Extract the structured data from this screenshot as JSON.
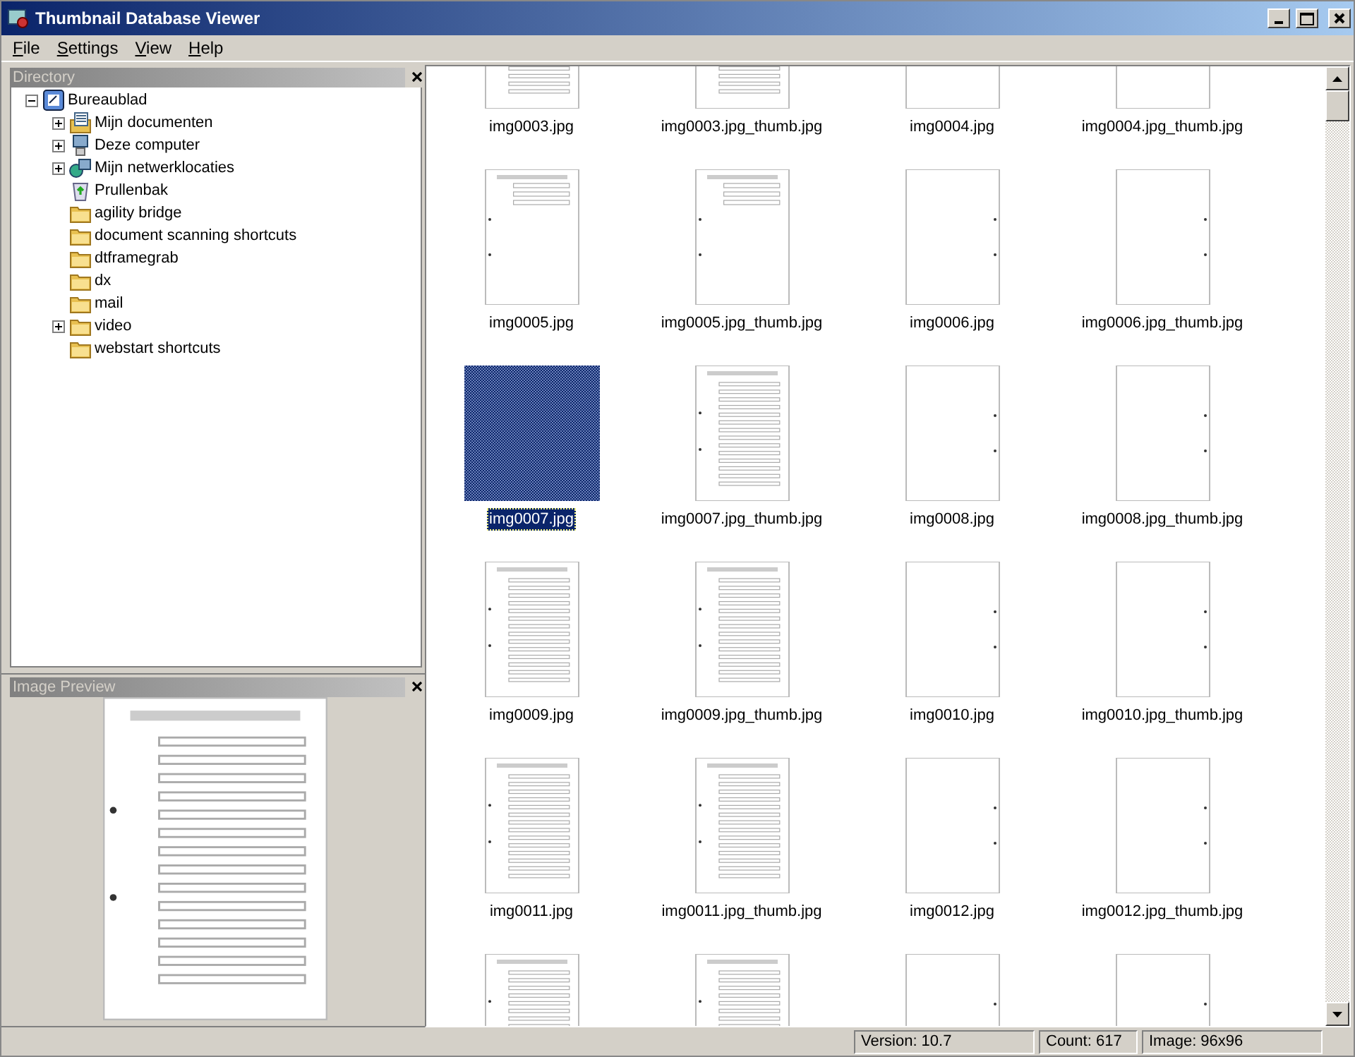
{
  "window": {
    "title": "Thumbnail Database Viewer"
  },
  "menu": [
    "File",
    "Settings",
    "View",
    "Help"
  ],
  "directory": {
    "title": "Directory",
    "tree": [
      {
        "label": "Bureaublad",
        "kind": "desktop",
        "expanded": true,
        "children": [
          {
            "label": "Mijn documenten",
            "kind": "documents",
            "expanded": false
          },
          {
            "label": "Deze computer",
            "kind": "computer",
            "expanded": false
          },
          {
            "label": "Mijn netwerklocaties",
            "kind": "network",
            "expanded": false
          },
          {
            "label": "Prullenbak",
            "kind": "recycle"
          },
          {
            "label": "agility bridge",
            "kind": "folder"
          },
          {
            "label": "document scanning shortcuts",
            "kind": "folder"
          },
          {
            "label": "dtframegrab",
            "kind": "folder"
          },
          {
            "label": "dx",
            "kind": "folder"
          },
          {
            "label": "mail",
            "kind": "folder"
          },
          {
            "label": "video",
            "kind": "folder",
            "expanded": false
          },
          {
            "label": "webstart shortcuts",
            "kind": "folder"
          }
        ]
      }
    ]
  },
  "preview": {
    "title": "Image Preview",
    "kind": "picture"
  },
  "thumbnails": [
    {
      "label": "img0003.jpg",
      "kind": "table",
      "selected": false
    },
    {
      "label": "img0003.jpg_thumb.jpg",
      "kind": "table",
      "selected": false
    },
    {
      "label": "img0004.jpg",
      "kind": "blank",
      "selected": false
    },
    {
      "label": "img0004.jpg_thumb.jpg",
      "kind": "blank",
      "selected": false
    },
    {
      "label": "img0005.jpg",
      "kind": "sparse",
      "selected": false
    },
    {
      "label": "img0005.jpg_thumb.jpg",
      "kind": "sparse",
      "selected": false
    },
    {
      "label": "img0006.jpg",
      "kind": "blank",
      "selected": false
    },
    {
      "label": "img0006.jpg_thumb.jpg",
      "kind": "blank",
      "selected": false
    },
    {
      "label": "img0007.jpg",
      "kind": "table",
      "selected": true
    },
    {
      "label": "img0007.jpg_thumb.jpg",
      "kind": "table",
      "selected": false
    },
    {
      "label": "img0008.jpg",
      "kind": "blank",
      "selected": false
    },
    {
      "label": "img0008.jpg_thumb.jpg",
      "kind": "blank",
      "selected": false
    },
    {
      "label": "img0009.jpg",
      "kind": "table",
      "selected": false
    },
    {
      "label": "img0009.jpg_thumb.jpg",
      "kind": "table",
      "selected": false
    },
    {
      "label": "img0010.jpg",
      "kind": "blank",
      "selected": false
    },
    {
      "label": "img0010.jpg_thumb.jpg",
      "kind": "blank",
      "selected": false
    },
    {
      "label": "img0011.jpg",
      "kind": "table",
      "selected": false
    },
    {
      "label": "img0011.jpg_thumb.jpg",
      "kind": "table",
      "selected": false
    },
    {
      "label": "img0012.jpg",
      "kind": "blank",
      "selected": false
    },
    {
      "label": "img0012.jpg_thumb.jpg",
      "kind": "blank",
      "selected": false
    },
    {
      "kind": "table",
      "selected": false
    },
    {
      "kind": "table",
      "selected": false
    },
    {
      "kind": "blank",
      "selected": false
    },
    {
      "kind": "blank",
      "selected": false
    }
  ],
  "status_bar": [
    "Version: 10.7",
    "Count: 617",
    "Image: 96x96"
  ]
}
